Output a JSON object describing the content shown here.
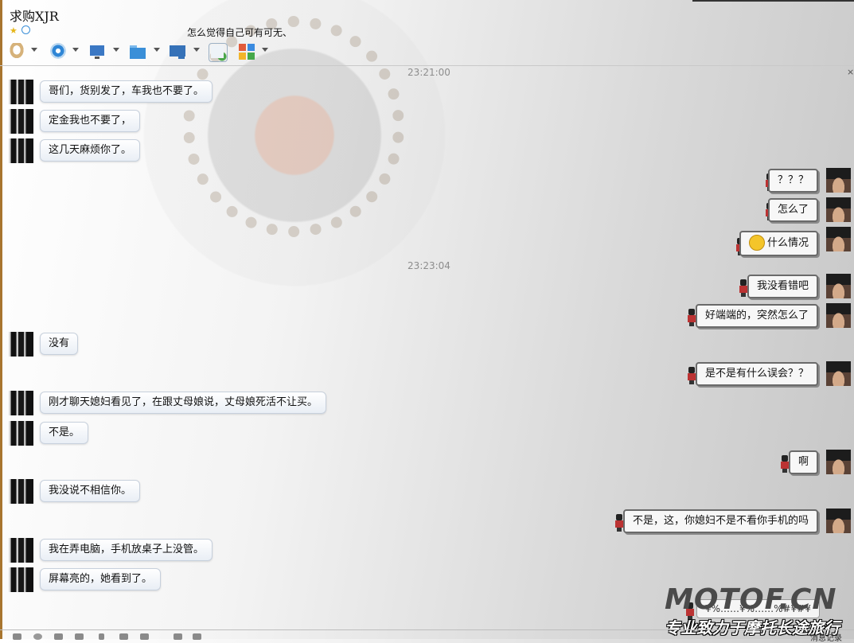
{
  "window": {
    "title": "求购XJR",
    "signature": "怎么觉得自己可有可无、"
  },
  "toolbar": {
    "items": [
      {
        "icon": "microphone-icon",
        "color": "#d6b27a"
      },
      {
        "icon": "webcam-icon",
        "color": "#2f86d6"
      },
      {
        "icon": "screen-share-icon",
        "color": "#3b78c4"
      },
      {
        "icon": "file-transfer-icon",
        "color": "#3a8fd8"
      },
      {
        "icon": "remote-assist-icon",
        "color": "#3672b8"
      },
      {
        "icon": "new-group-chat-icon",
        "color": "#4aa64a"
      },
      {
        "icon": "apps-grid-icon",
        "color": "#e25b3a"
      }
    ]
  },
  "chat": {
    "timestamps": [
      "23:21:00",
      "23:23:04"
    ],
    "messages": [
      {
        "side": "left",
        "text": "哥们，货别发了，车我也不要了。"
      },
      {
        "side": "left",
        "text": "定金我也不要了，"
      },
      {
        "side": "left",
        "text": "这几天麻烦你了。"
      },
      {
        "side": "right",
        "text": "？？？"
      },
      {
        "side": "right",
        "text": "怎么了"
      },
      {
        "side": "right",
        "text": "什么情况",
        "emoji": "shocked-face-icon"
      },
      {
        "side": "right",
        "text": "我没看错吧"
      },
      {
        "side": "right",
        "text": "好端端的，突然怎么了"
      },
      {
        "side": "left",
        "text": "没有"
      },
      {
        "side": "right",
        "text": "是不是有什么误会？？"
      },
      {
        "side": "left",
        "text": "刚才聊天媳妇看见了，在跟丈母娘说，丈母娘死活不让买。"
      },
      {
        "side": "left",
        "text": "不是。"
      },
      {
        "side": "right",
        "text": "啊"
      },
      {
        "side": "left",
        "text": "我没说不相信你。"
      },
      {
        "side": "right",
        "text": "不是，这，你媳妇不是不看你手机的吗"
      },
      {
        "side": "left",
        "text": "我在弄电脑，手机放桌子上没管。"
      },
      {
        "side": "left",
        "text": "屏幕亮的，她看到了。"
      },
      {
        "side": "right",
        "text": "¥%……¥%……%#¥#¥"
      }
    ]
  },
  "watermark": {
    "line1": "MOTOF.CN",
    "line2": "专业致力于摩托长途旅行"
  },
  "bottom": {
    "history_label": "消息记录"
  },
  "colors": {
    "left_bubble_border": "#c7d0dc",
    "right_bubble_border": "#6a6a6a",
    "timestamp": "#8d8d8d",
    "accent_bar": "#a8752f"
  }
}
